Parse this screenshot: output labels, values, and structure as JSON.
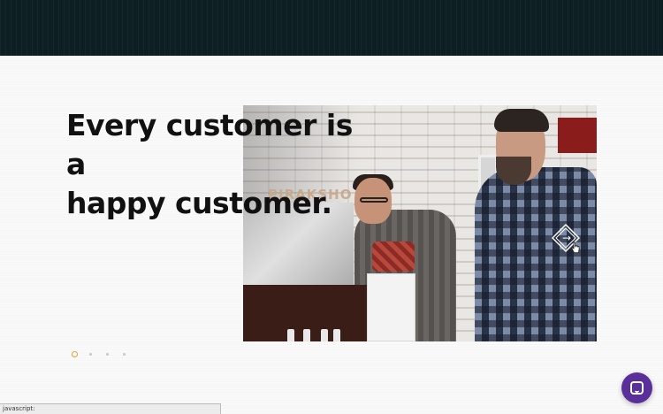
{
  "hero": {
    "headline_line1": "Every customer is a",
    "headline_line2": "happy customer.",
    "photo_sign_text": "PIRAKSHO",
    "photo_alt": "Two shop staff working at a sneaker store counter"
  },
  "carousel": {
    "next_icon": "arrow-right-icon",
    "next_glyph": "→",
    "slide_count": 4,
    "active_slide": 1
  },
  "chat": {
    "icon": "chat-icon"
  },
  "status_bar": {
    "text": "javascript:"
  },
  "colors": {
    "top_band": "#0e1f23",
    "accent_dot": "#e0a23a",
    "chat_button": "#5b2f9a",
    "headline": "#111111"
  }
}
